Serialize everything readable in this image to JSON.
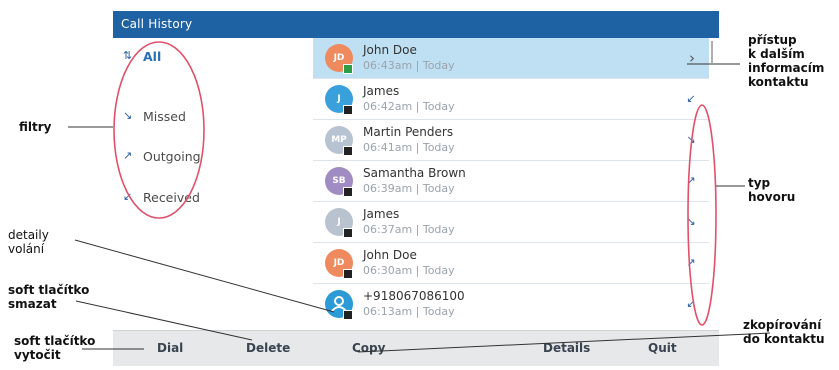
{
  "title": "Call History",
  "filters": [
    {
      "label": "All",
      "icon": "all-calls-icon",
      "active": true
    },
    {
      "label": "Missed",
      "icon": "missed-call-icon",
      "active": false
    },
    {
      "label": "Outgoing",
      "icon": "outgoing-call-icon",
      "active": false
    },
    {
      "label": "Received",
      "icon": "received-call-icon",
      "active": false
    }
  ],
  "calls": [
    {
      "initials": "JD",
      "name": "John Doe",
      "time": "06:43am | Today",
      "avatar_color": "#ee8a5e",
      "presence": "green",
      "selected": true
    },
    {
      "initials": "J",
      "name": "James",
      "time": "06:42am | Today",
      "avatar_color": "#3aa0dc",
      "presence": "dark",
      "calltype": "received-call-icon"
    },
    {
      "initials": "MP",
      "name": "Martin Penders",
      "time": "06:41am | Today",
      "avatar_color": "#b7c3d1",
      "presence": "dark",
      "calltype": "missed-call-icon"
    },
    {
      "initials": "SB",
      "name": "Samantha Brown",
      "time": "06:39am | Today",
      "avatar_color": "#a08cc2",
      "presence": "dark",
      "calltype": "outgoing-call-icon"
    },
    {
      "initials": "J",
      "name": "James",
      "time": "06:37am | Today",
      "avatar_color": "#b9c2cf",
      "presence": "dark",
      "calltype": "missed-call-icon"
    },
    {
      "initials": "JD",
      "name": "John Doe",
      "time": "06:30am | Today",
      "avatar_color": "#ee8a5e",
      "presence": "dark",
      "calltype": "outgoing-call-icon"
    },
    {
      "initials": "",
      "name": "+918067086100",
      "time": "06:13am | Today",
      "avatar_color": "#2b9ad6",
      "presence": "dark",
      "calltype": "received-call-icon"
    }
  ],
  "softkeys": {
    "dial": "Dial",
    "delete": "Delete",
    "copy": "Copy",
    "details": "Details",
    "quit": "Quit"
  },
  "annotations": {
    "filters": "filtry",
    "details_access": [
      "přístup",
      "k dalším",
      "informacím",
      "kontaktu"
    ],
    "call_type": [
      "typ",
      "hovoru"
    ],
    "call_details": [
      "detaily",
      "volání"
    ],
    "soft_delete": [
      "soft tlačítko",
      "smazat"
    ],
    "soft_dial": [
      "soft tlačítko",
      "vytočit"
    ],
    "copy_to_contact": [
      "zkopírování",
      "do kontaktu"
    ]
  },
  "colors": {
    "title_bar": "#1f62a3",
    "selected_row": "#bfe0f3",
    "highlight_ellipse": "#e0506a",
    "accent": "#2a6fb6"
  }
}
